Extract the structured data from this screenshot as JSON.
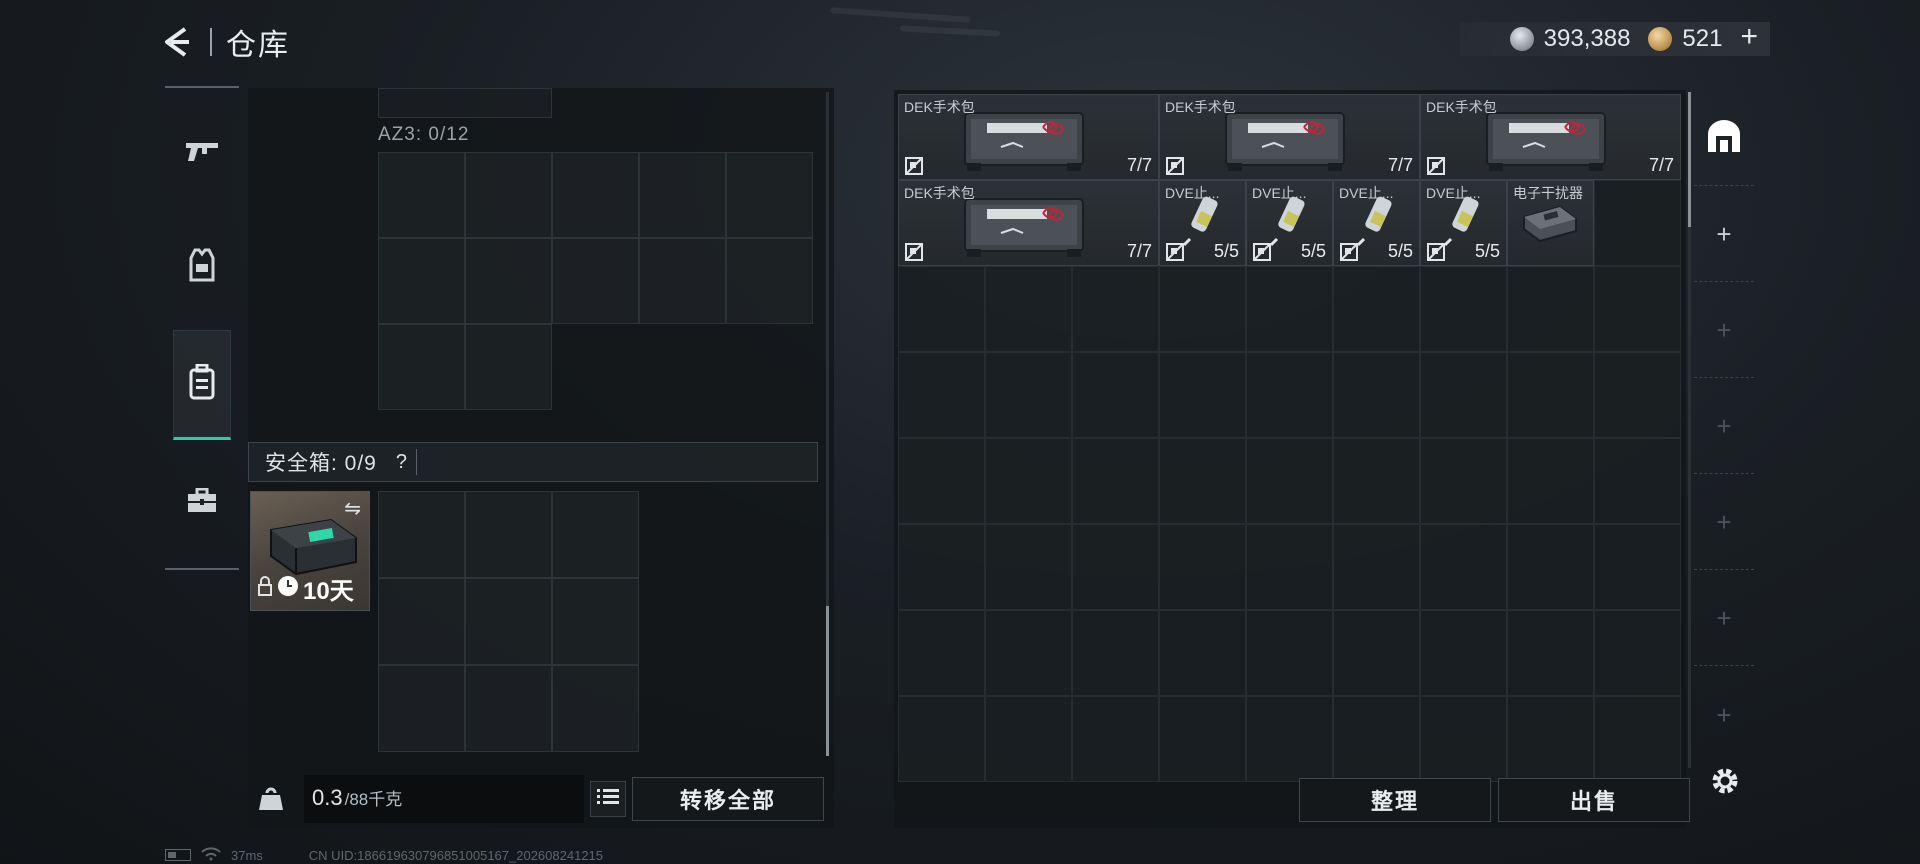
{
  "header": {
    "title": "仓库",
    "silver_amount": "393,388",
    "gold_amount": "521",
    "add_symbol": "+"
  },
  "left_nav": {
    "items": [
      {
        "name": "weapons",
        "icon": "gun-icon",
        "active": false
      },
      {
        "name": "gear",
        "icon": "armor-vest-icon",
        "active": false
      },
      {
        "name": "backpack",
        "icon": "backpack-icon",
        "active": true
      },
      {
        "name": "toolbox",
        "icon": "briefcase-icon",
        "active": false
      }
    ]
  },
  "left_panel": {
    "az3_label": "AZ3: 0/12",
    "safe_box_title": "安全箱: 0/9",
    "help_label": "?",
    "safe_item": {
      "days": "10天",
      "swap_icon": "swap-icon",
      "lock_icon": "lock-icon",
      "clock_icon": "clock-icon"
    },
    "weight_current": "0.3",
    "weight_max": "/88千克",
    "transfer_all_label": "转移全部"
  },
  "stash": {
    "items": [
      {
        "name": "DEK手术包",
        "count": "7/7",
        "type": "medkit"
      },
      {
        "name": "DEK手术包",
        "count": "7/7",
        "type": "medkit"
      },
      {
        "name": "DEK手术包",
        "count": "7/7",
        "type": "medkit"
      },
      {
        "name": "DEK手术包",
        "count": "7/7",
        "type": "medkit"
      },
      {
        "name": "DVE止...",
        "count": "5/5",
        "type": "syringe"
      },
      {
        "name": "DVE止...",
        "count": "5/5",
        "type": "syringe"
      },
      {
        "name": "DVE止...",
        "count": "5/5",
        "type": "syringe"
      },
      {
        "name": "DVE止...",
        "count": "5/5",
        "type": "syringe"
      },
      {
        "name": "电子干扰器",
        "count": "",
        "type": "jammer"
      }
    ],
    "sort_label": "整理",
    "sell_label": "出售",
    "sidebar": {
      "plus_symbol": "+"
    }
  },
  "status_bar": {
    "ping": "37ms",
    "uid": "CN UID:1866196307968510051​67_202608241215"
  }
}
